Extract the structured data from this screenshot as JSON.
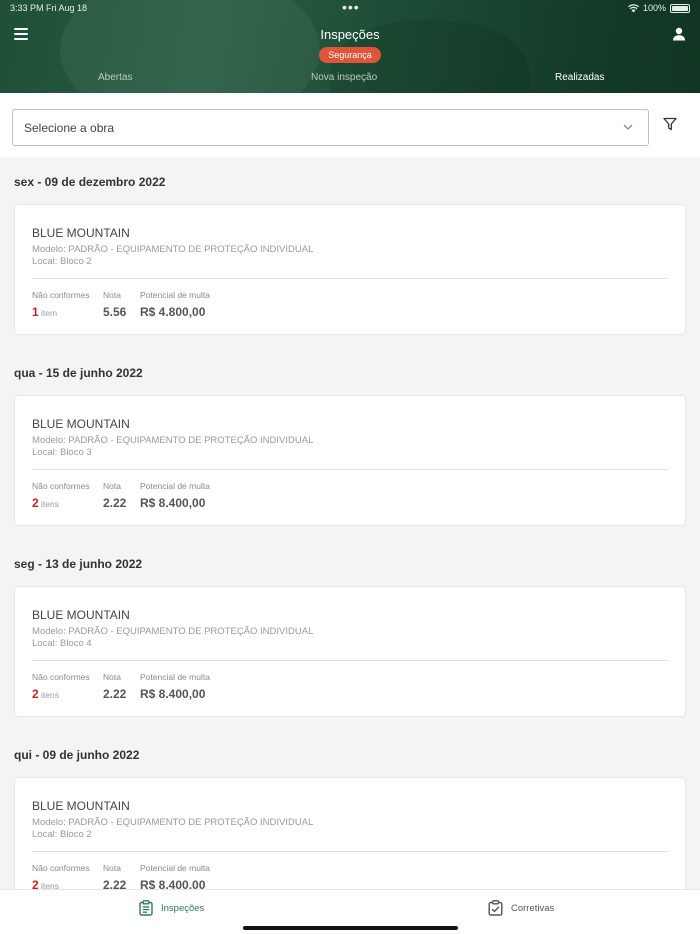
{
  "status_bar": {
    "time": "3:33 PM   Fri Aug 18",
    "battery": "100%"
  },
  "header": {
    "title": "Inspeções",
    "badge": "Segurança",
    "tabs": [
      {
        "label": "Abertas",
        "active": false
      },
      {
        "label": "Nova inspeção",
        "active": false
      },
      {
        "label": "Realizadas",
        "active": true
      }
    ]
  },
  "filter": {
    "select_value": "Selecione a obra"
  },
  "groups": [
    {
      "date": "sex - 09 de dezembro 2022",
      "card": {
        "name": "BLUE MOUNTAIN",
        "model": "Modelo: PADRÃO - EQUIPAMENTO DE PROTEÇÃO INDIVIDUAL",
        "local": "Local: Bloco 2",
        "nc_label": "Não conformes",
        "nc_count": "1",
        "nc_unit": "item",
        "nota_label": "Nota",
        "nota": "5.56",
        "fine_label": "Potencial de multa",
        "fine": "R$ 4.800,00"
      }
    },
    {
      "date": "qua - 15 de junho 2022",
      "card": {
        "name": "BLUE MOUNTAIN",
        "model": "Modelo: PADRÃO - EQUIPAMENTO DE PROTEÇÃO INDIVIDUAL",
        "local": "Local: Bloco 3",
        "nc_label": "Não conformes",
        "nc_count": "2",
        "nc_unit": "itens",
        "nota_label": "Nota",
        "nota": "2.22",
        "fine_label": "Potencial de multa",
        "fine": "R$ 8.400,00"
      }
    },
    {
      "date": "seg - 13 de junho 2022",
      "card": {
        "name": "BLUE MOUNTAIN",
        "model": "Modelo: PADRÃO - EQUIPAMENTO DE PROTEÇÃO INDIVIDUAL",
        "local": "Local: Bloco 4",
        "nc_label": "Não conformes",
        "nc_count": "2",
        "nc_unit": "itens",
        "nota_label": "Nota",
        "nota": "2.22",
        "fine_label": "Potencial de multa",
        "fine": "R$ 8.400,00"
      }
    },
    {
      "date": "qui - 09 de junho 2022",
      "card": {
        "name": "BLUE MOUNTAIN",
        "model": "Modelo: PADRÃO - EQUIPAMENTO DE PROTEÇÃO INDIVIDUAL",
        "local": "Local: Bloco 2",
        "nc_label": "Não conformes",
        "nc_count": "2",
        "nc_unit": "itens",
        "nota_label": "Nota",
        "nota": "2.22",
        "fine_label": "Potencial de multa",
        "fine": "R$ 8.400,00"
      }
    }
  ],
  "bottom_nav": [
    {
      "label": "Inspeções",
      "icon": "clipboard-list-icon",
      "active": true
    },
    {
      "label": "Corretivas",
      "icon": "clipboard-check-icon",
      "active": false
    }
  ],
  "colors": {
    "header_green": "#1f4f37",
    "badge": "#e0553a",
    "alert_red": "#d21f1f",
    "active_nav": "#2d7a55"
  }
}
